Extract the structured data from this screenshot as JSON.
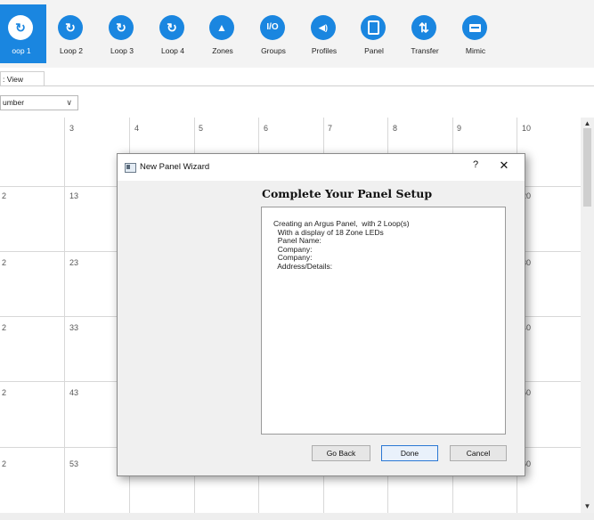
{
  "toolbar": {
    "items": [
      {
        "label": "oop 1",
        "icon": "refresh-icon",
        "glyph": "↻",
        "active": true
      },
      {
        "label": "Loop 2",
        "icon": "refresh-icon",
        "glyph": "↻"
      },
      {
        "label": "Loop 3",
        "icon": "refresh-icon",
        "glyph": "↻"
      },
      {
        "label": "Loop 4",
        "icon": "refresh-icon",
        "glyph": "↻"
      },
      {
        "label": "Zones",
        "icon": "triangle-icon",
        "glyph": "▲"
      },
      {
        "label": "Groups",
        "icon": "io-icon",
        "glyph": "I/O"
      },
      {
        "label": "Profiles",
        "icon": "speaker-icon",
        "glyph": "◀)"
      },
      {
        "label": "Panel",
        "icon": "panel-icon",
        "glyph": ""
      },
      {
        "label": "Transfer",
        "icon": "transfer-arrows-icon",
        "glyph": "⇅"
      },
      {
        "label": "Mimic",
        "icon": "mimic-card-icon",
        "glyph": ""
      }
    ]
  },
  "view_tab": {
    "label": ": View"
  },
  "sort_select": {
    "value": "umber"
  },
  "grid": {
    "header": [
      "3",
      "4",
      "5",
      "6",
      "7",
      "8",
      "9",
      "10"
    ],
    "rows": [
      {
        "left": "2",
        "num": "13",
        "right": "20"
      },
      {
        "left": "2",
        "num": "23",
        "right": "30"
      },
      {
        "left": "2",
        "num": "33",
        "right": "40"
      },
      {
        "left": "2",
        "num": "43",
        "right": "50"
      },
      {
        "left": "2",
        "num": "53",
        "right": "60"
      }
    ]
  },
  "dialog": {
    "title": "New Panel Wizard",
    "help": "?",
    "close": "✕",
    "heading": "Complete Your Panel Setup",
    "summary_lines": [
      "Creating an Argus Panel,  with 2 Loop(s)",
      "  With a display of 18 Zone LEDs",
      "  Panel Name:",
      "  Company:",
      "  Company:",
      "  Address/Details:"
    ],
    "buttons": {
      "back": "Go Back",
      "done": "Done",
      "cancel": "Cancel"
    }
  },
  "colors": {
    "accent": "#1a86e0"
  }
}
